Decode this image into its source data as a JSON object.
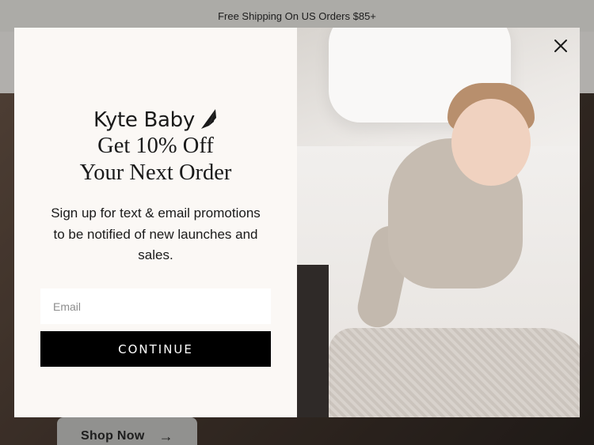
{
  "announcement": {
    "text": "Free Shipping On US Orders $85+"
  },
  "hero": {
    "cta_label": "Shop Now",
    "cta_icon": "arrow-right-icon"
  },
  "popup": {
    "brand": "Kyte Baby",
    "headline_line1": "Get 10% Off",
    "headline_line2": "Your Next Order",
    "subtext": "Sign up for text & email promotions to be notified of new launches and sales.",
    "email_placeholder": "Email",
    "button_label": "CONTINUE",
    "close_icon": "close-icon",
    "image_alt": "toddler-in-pajamas-photo"
  }
}
